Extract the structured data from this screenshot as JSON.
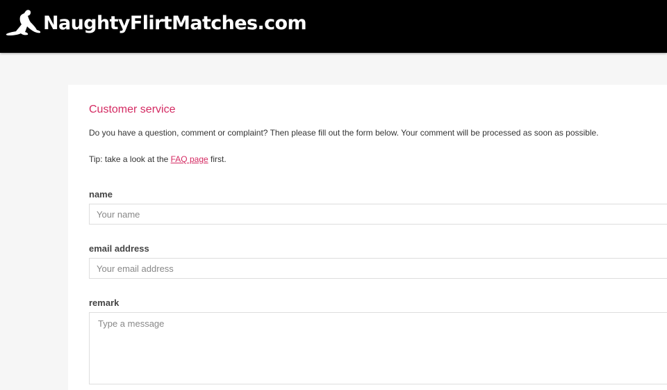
{
  "header": {
    "logo_text": "NaughtyFlirtMatches.com",
    "logo_icon": "silhouette-woman-icon",
    "background_color": "#000000"
  },
  "page": {
    "title": "Customer service",
    "intro": "Do you have a question, comment or complaint? Then please fill out the form below. Your comment will be processed as soon as possible.",
    "tip_prefix": "Tip: take a look at the ",
    "tip_link": "FAQ page",
    "tip_suffix": " first.",
    "accent_color": "#d42a62"
  },
  "form": {
    "name_label": "name",
    "name_placeholder": "Your name",
    "name_value": "",
    "email_label": "email address",
    "email_placeholder": "Your email address",
    "email_value": "",
    "remark_label": "remark",
    "remark_placeholder": "Type a message",
    "remark_value": ""
  }
}
